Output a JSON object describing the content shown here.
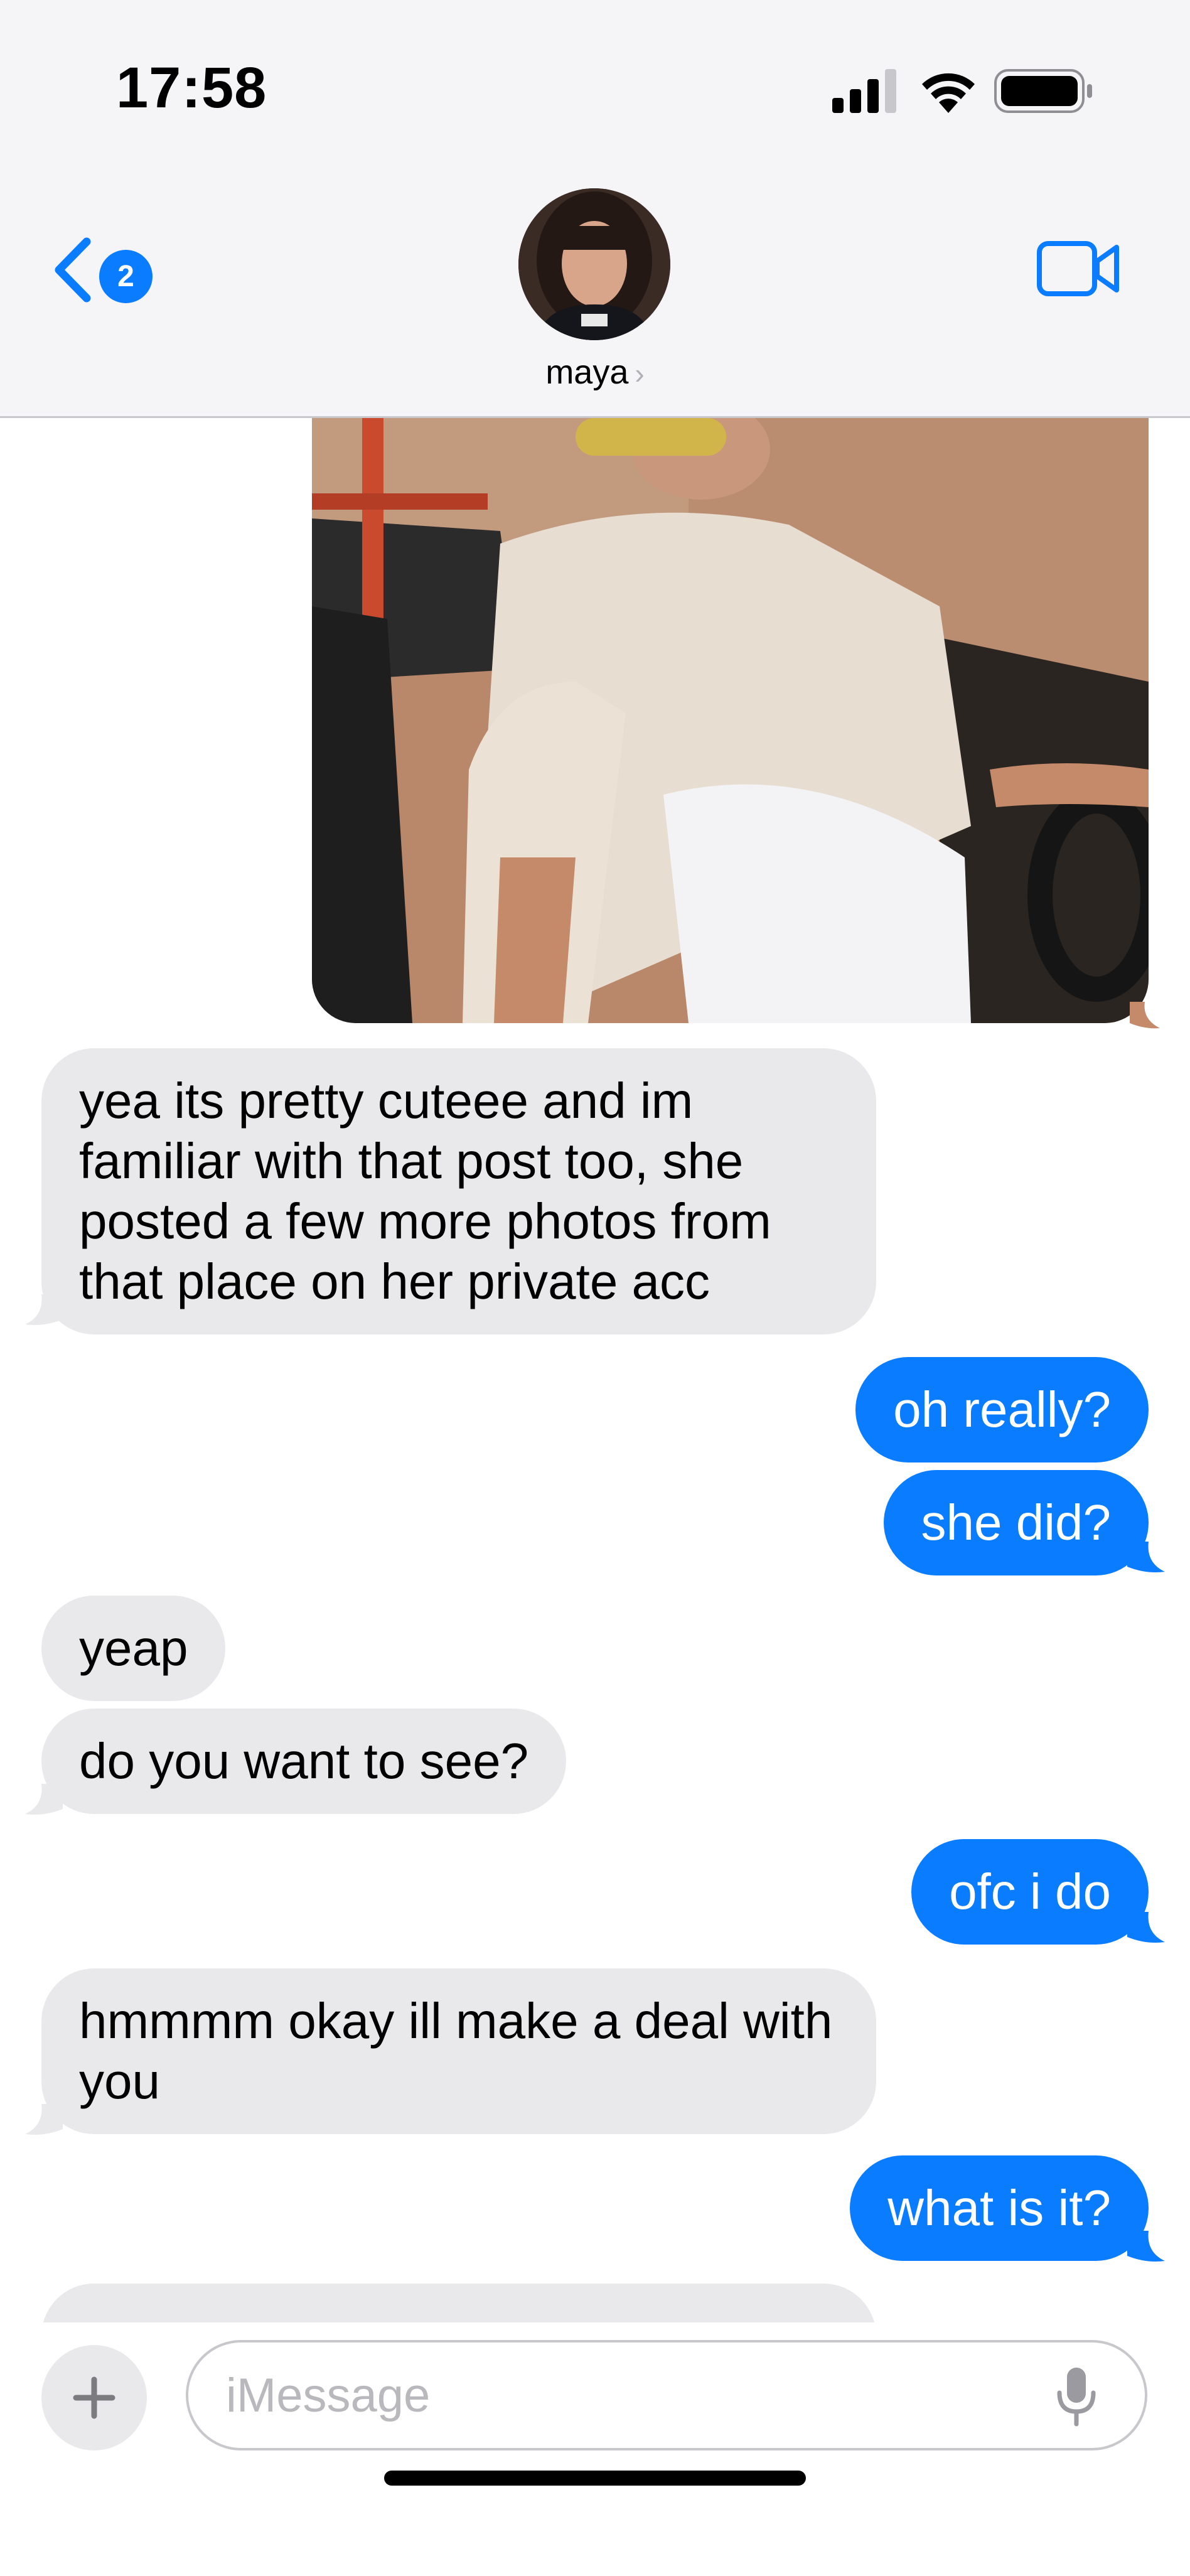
{
  "status_bar": {
    "time": "17:58",
    "icons": [
      "cellular-icon",
      "wifi-icon",
      "battery-icon"
    ]
  },
  "header": {
    "back_badge": "2",
    "contact_name": "maya",
    "chevron": "›",
    "icons": [
      "back-chevron-icon",
      "video-call-icon"
    ]
  },
  "messages": [
    {
      "type": "photo",
      "from": "me"
    },
    {
      "type": "text",
      "from": "them",
      "text": "yea its pretty cuteee and im familiar with that post too, she posted a few more photos from that place on her private acc"
    },
    {
      "type": "text",
      "from": "me",
      "text": "oh really?"
    },
    {
      "type": "text",
      "from": "me",
      "text": "she did?"
    },
    {
      "type": "text",
      "from": "them",
      "text": "yeap"
    },
    {
      "type": "text",
      "from": "them",
      "text": "do you want to see?"
    },
    {
      "type": "text",
      "from": "me",
      "text": "ofc i do"
    },
    {
      "type": "text",
      "from": "them",
      "text": "hmmmm okay ill make a deal with you"
    },
    {
      "type": "text",
      "from": "me",
      "text": "what is it?"
    }
  ],
  "composer": {
    "placeholder": "iMessage",
    "icons": [
      "plus-icon",
      "microphone-icon"
    ]
  },
  "colors": {
    "outgoing": "#0a7cff",
    "incoming": "#e9e9eb",
    "header_bg": "#f5f5f7"
  }
}
